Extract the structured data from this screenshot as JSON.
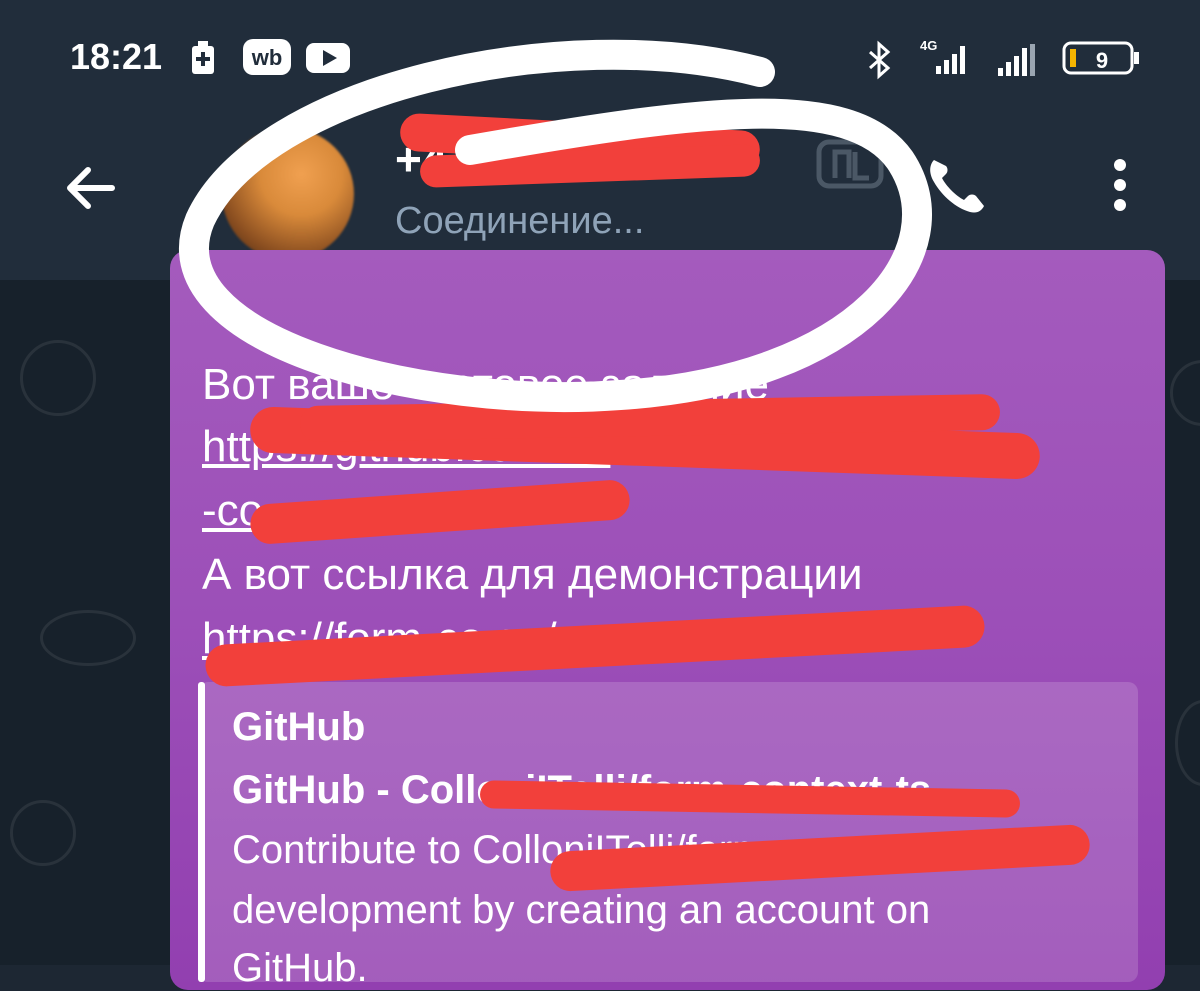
{
  "status_bar": {
    "time": "18:21",
    "battery": "9",
    "network": "4G",
    "icons": [
      "battery-saver-icon",
      "wb-icon",
      "youtube-icon",
      "bluetooth-icon",
      "signal-icon",
      "signal-icon-2",
      "battery-icon"
    ],
    "wb_label": "wb"
  },
  "header": {
    "contact_name": "+4              3",
    "status": "Соединение...",
    "back_icon": "arrow-left-icon",
    "call_icon": "phone-icon",
    "menu_icon": "more-vertical-icon"
  },
  "message": {
    "lines": [
      "Вот ваше тестовое задание",
      "https://github.com/                    m",
      "-co",
      "А вот ссылка для демонстрации",
      "https://form-co                        op/"
    ],
    "preview": {
      "site": "GitHub",
      "title": "GitHub - ColloniITolli/form-context-ts",
      "description_1": "Contribute to ColloniITolli/form-context-ts",
      "description_2": "development by creating an account on",
      "description_3": "GitHub."
    }
  },
  "colors": {
    "header_bg": "#212d3b",
    "chat_bg": "#17212b",
    "bubble": "#9c4fb8",
    "redaction": "#f2403b",
    "annotation_circle": "#ffffff"
  }
}
